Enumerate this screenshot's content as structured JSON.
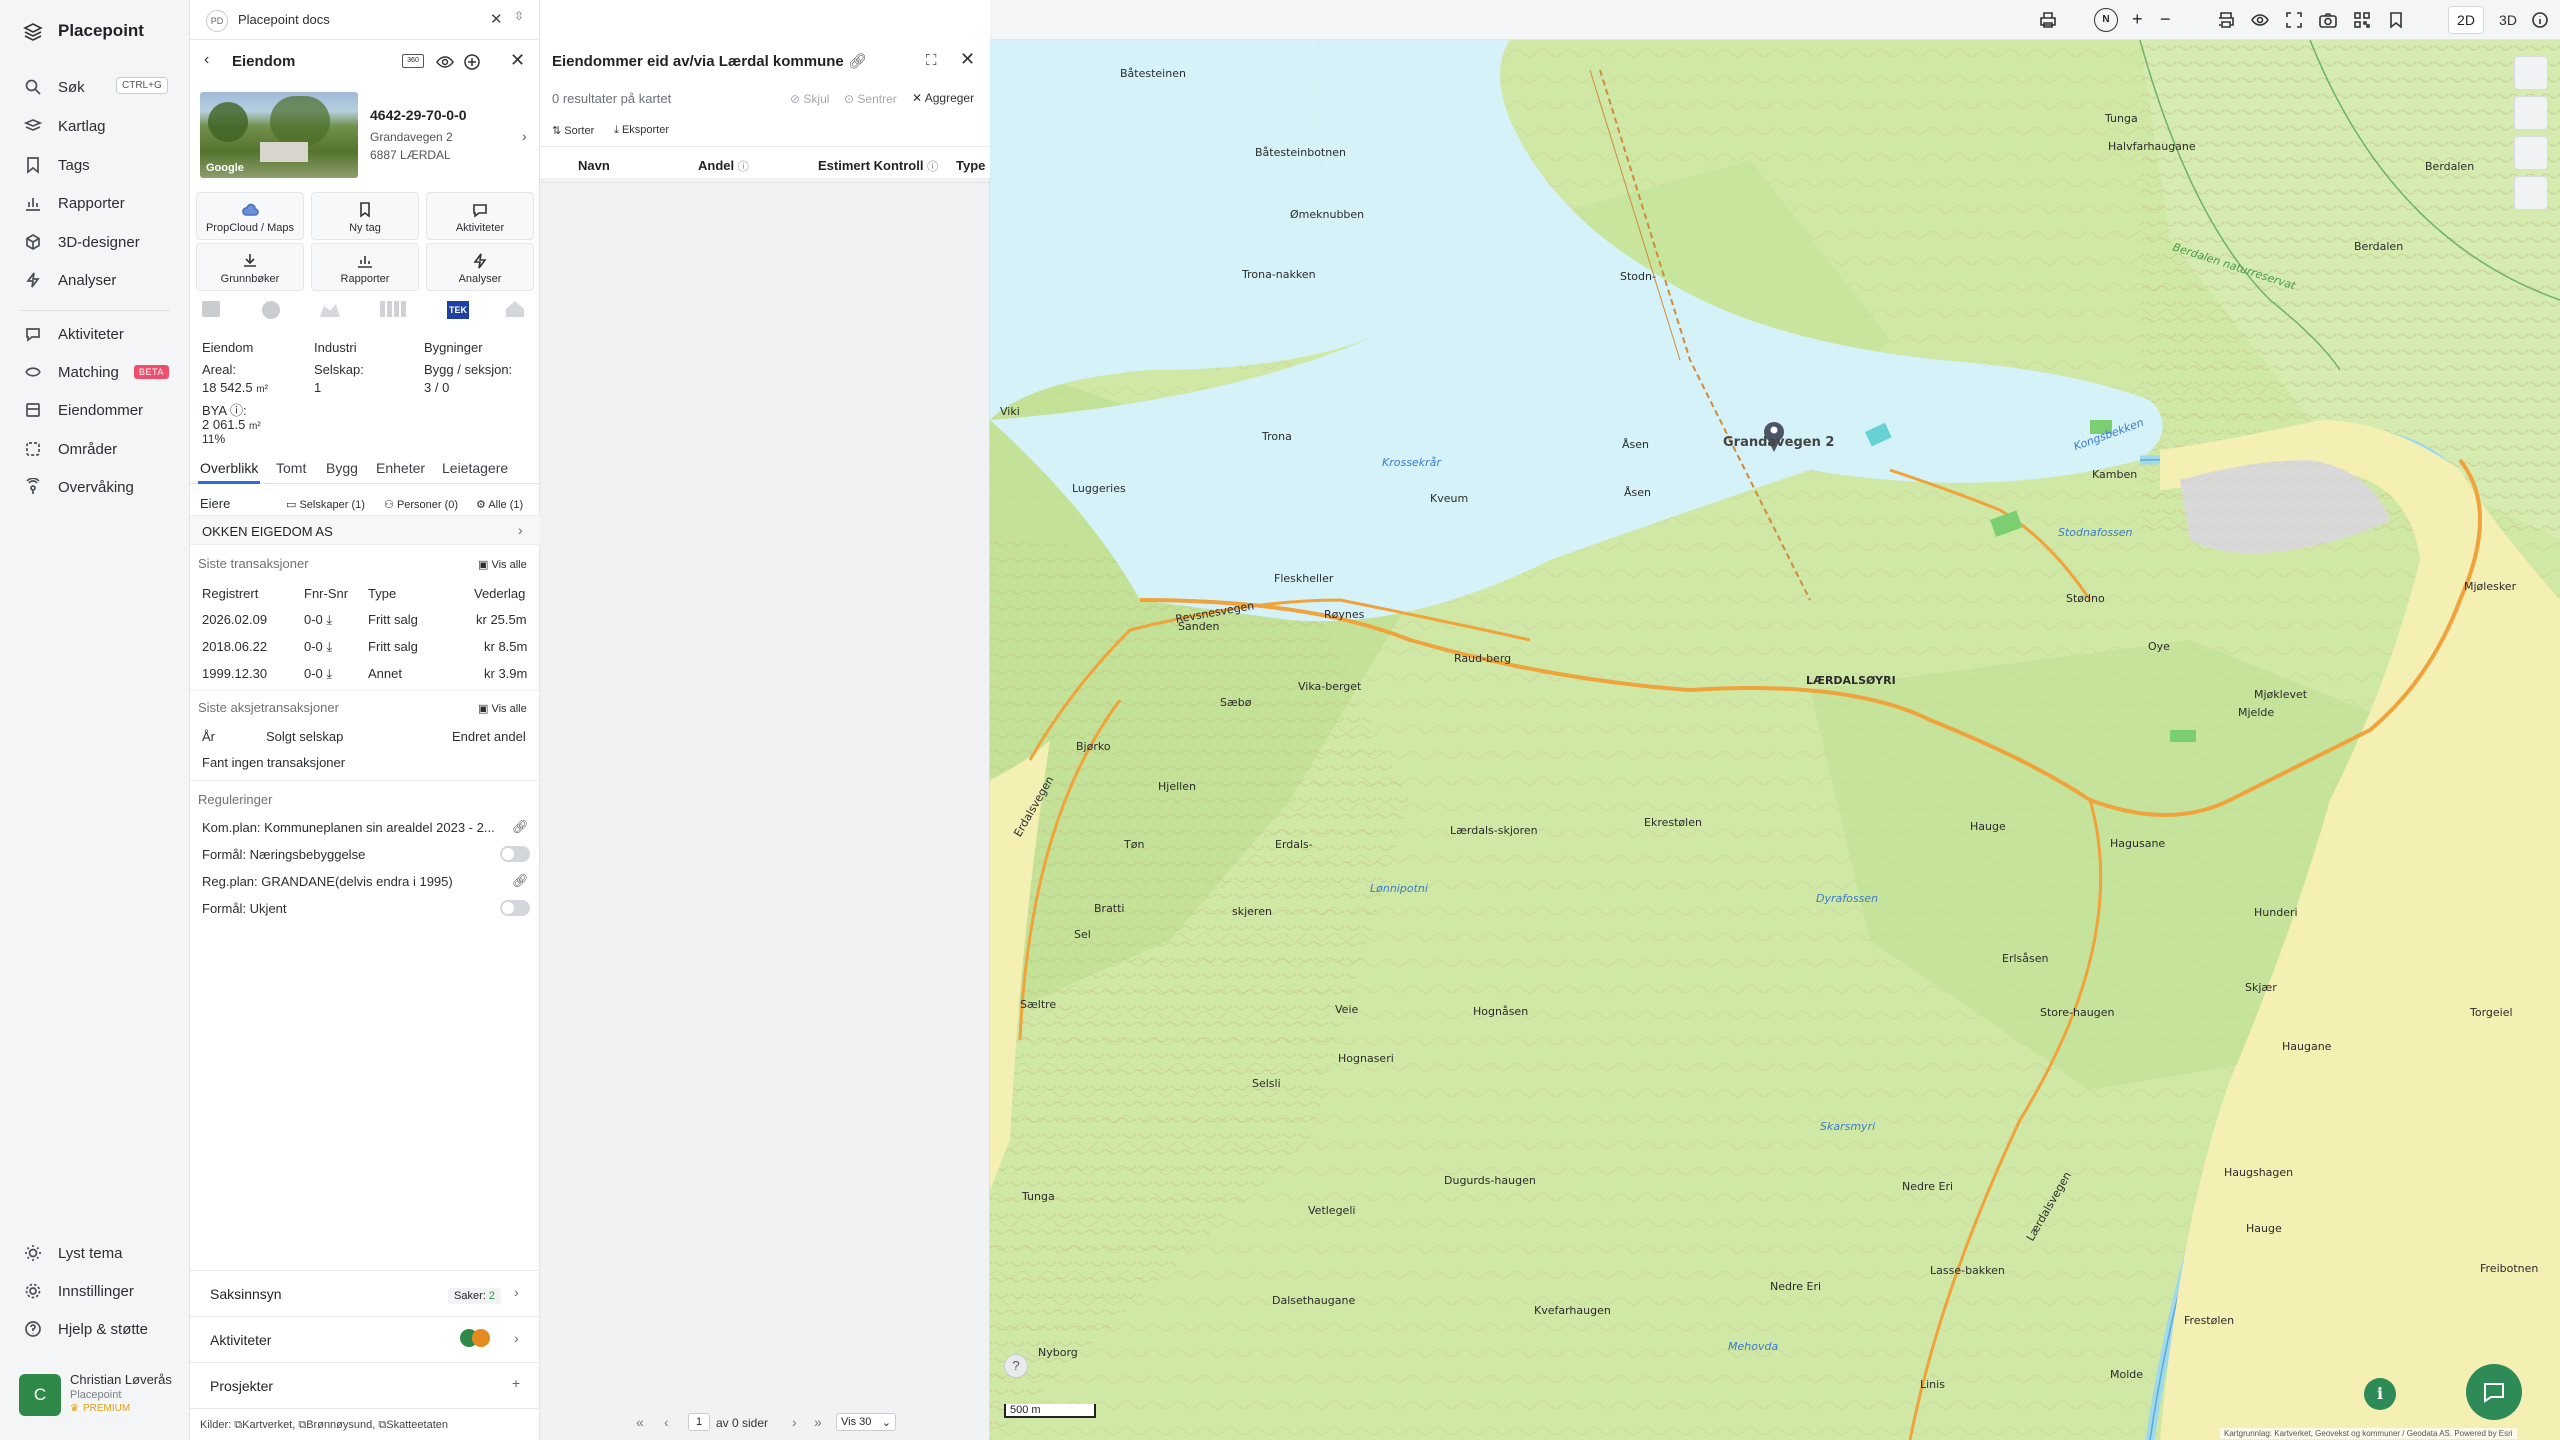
{
  "app": {
    "name": "Placepoint",
    "workspace": "Placepoint docs",
    "workspace_initials": "PD"
  },
  "nav": {
    "items": [
      {
        "label": "Søk",
        "icon": "search-icon",
        "shortcut": "CTRL+G"
      },
      {
        "label": "Kartlag",
        "icon": "layers-icon"
      },
      {
        "label": "Tags",
        "icon": "bookmark-icon"
      },
      {
        "label": "Rapporter",
        "icon": "chart-icon"
      },
      {
        "label": "3D-designer",
        "icon": "cube-icon"
      },
      {
        "label": "Analyser",
        "icon": "lightning-icon"
      },
      {
        "label": "Aktiviteter",
        "icon": "chat-icon"
      },
      {
        "label": "Matching",
        "icon": "matching-icon",
        "badge": "BETA"
      },
      {
        "label": "Eiendommer",
        "icon": "building-icon"
      },
      {
        "label": "Områder",
        "icon": "area-icon"
      },
      {
        "label": "Overvåking",
        "icon": "monitor-icon"
      }
    ],
    "bottom": [
      {
        "label": "Lyst tema",
        "icon": "sun-icon"
      },
      {
        "label": "Innstillinger",
        "icon": "gear-icon"
      },
      {
        "label": "Hjelp & støtte",
        "icon": "help-icon"
      }
    ],
    "user": {
      "initial": "C",
      "name": "Christian Løverås",
      "org": "Placepoint",
      "plan": "PREMIUM"
    }
  },
  "property": {
    "header": "Eiendom",
    "id": "4642-29-70-0-0",
    "address": "Grandavegen 2",
    "postal": "6887 LÆRDAL",
    "photo_credit": "Google",
    "tiles": [
      {
        "label": "PropCloud / Maps",
        "icon": "cloud-icon"
      },
      {
        "label": "Ny tag",
        "icon": "bookmark-icon"
      },
      {
        "label": "Aktiviteter",
        "icon": "chat-icon"
      },
      {
        "label": "Grunnbøker",
        "icon": "download-icon"
      },
      {
        "label": "Rapporter",
        "icon": "chart-icon"
      },
      {
        "label": "Analyser",
        "icon": "lightning-icon"
      }
    ],
    "tek_badge": "TEK",
    "summary": {
      "type_label": "Eiendom",
      "category": "Industri",
      "buildings_label": "Bygninger",
      "area_label": "Areal:",
      "area_value": "18 542.5",
      "area_unit": "m²",
      "company_label": "Selskap:",
      "company_value": "1",
      "byg_label": "Bygg / seksjon:",
      "byg_value": "3 / 0",
      "bya_label": "BYA ⓘ:",
      "bya_value": "2 061.5",
      "bya_unit": "m²",
      "bya_pct": "11%"
    },
    "tabs": [
      "Overblikk",
      "Tomt",
      "Bygg",
      "Enheter",
      "Leietagere"
    ],
    "owners": {
      "label": "Eiere",
      "filters": [
        "Selskaper (1)",
        "Personer (0)",
        "Alle (1)"
      ],
      "list": [
        "OKKEN EIGEDOM AS"
      ]
    },
    "transactions": {
      "title": "Siste transaksjoner",
      "link": "Vis alle",
      "columns": [
        "Registrert",
        "Fnr-Snr",
        "Type",
        "Vederlag"
      ],
      "rows": [
        {
          "date": "2026.02.09",
          "fnr": "0-0",
          "type": "Fritt salg",
          "amount": "kr 25.5m"
        },
        {
          "date": "2018.06.22",
          "fnr": "0-0",
          "type": "Fritt salg",
          "amount": "kr 8.5m"
        },
        {
          "date": "1999.12.30",
          "fnr": "0-0",
          "type": "Annet",
          "amount": "kr 3.9m"
        }
      ]
    },
    "share_tx": {
      "title": "Siste aksjetransaksjoner",
      "link": "Vis alle",
      "columns": [
        "År",
        "Solgt selskap",
        "Endret andel"
      ],
      "empty": "Fant ingen transaksjoner"
    },
    "regulations": {
      "title": "Reguleringer",
      "items": [
        {
          "text": "Kom.plan: Kommuneplanen sin arealdel 2023 - 2...",
          "kind": "link"
        },
        {
          "text": "Formål: Næringsbebyggelse",
          "kind": "toggle"
        },
        {
          "text": "Reg.plan: GRANDANE(delvis endra i 1995)",
          "kind": "link"
        },
        {
          "text": "Formål: Ukjent",
          "kind": "toggle"
        }
      ]
    },
    "bottom_sections": [
      {
        "label": "Saksinnsyn",
        "meta_label": "Saker:",
        "meta_value": "2"
      },
      {
        "label": "Aktiviteter"
      },
      {
        "label": "Prosjekter"
      }
    ],
    "sources": {
      "label": "Kilder:",
      "items": [
        "Kartverket,",
        "Brønnøysund,",
        "Skatteetaten"
      ]
    }
  },
  "result": {
    "title": "Eiendommer eid av/via Lærdal kommune",
    "count_text": "0 resultater på kartet",
    "actions": [
      "Skjul",
      "Sentrer",
      "Aggreger"
    ],
    "tools": [
      "Sorter",
      "Eksporter"
    ],
    "columns": [
      "Navn",
      "Andel",
      "Estimert Kontroll",
      "Type"
    ],
    "pagination": {
      "page": "1",
      "of_text": "av 0 sider",
      "per_page": "Vis 30"
    }
  },
  "map": {
    "mode_2d": "2D",
    "mode_3d": "3D",
    "compass": "N",
    "marker_label": "Grandavegen 2",
    "scale": "500 m",
    "attribution": "Kartgrunnlag: Kartverket, Geovekst og kommuner / Geodata AS. Powered by Esri",
    "labels": {
      "places": [
        "Båtesteinen",
        "Tunga",
        "Berdalen",
        "Halvfarhaugane",
        "Båtesteinbotnen",
        "Ømeknubben",
        "Stodn-",
        "Trona-nakken",
        "Trona",
        "Åsen",
        "Kamben",
        "Åsen",
        "Luggeries",
        "Kveum",
        "Fleskheller",
        "Røynes",
        "Revsnesvegen",
        "Sanden",
        "Raud-berg",
        "LÆRDALSØYRI",
        "Stødno",
        "Oye",
        "Mjelde",
        "Mjøklevet",
        "Viki",
        "Bjørko",
        "Vika-berget",
        "Sæbø",
        "Ekrestølen",
        "Lærdals-skjoren",
        "Erdalsvegen",
        "Hjellen",
        "Tøn",
        "Erdals-",
        "skjeren",
        "Bratti",
        "Sel",
        "Lærdalsvegen",
        "Hauge",
        "Hagusane",
        "Erlsåsen",
        "Hunderi",
        "Skjær",
        "Haugane",
        "Store-haugen",
        "Veie",
        "Hognåsen",
        "Hognaseri",
        "Sæltre",
        "Selsli",
        "Tunga",
        "Dugurds-haugen",
        "Vetlegeli",
        "Kvefarhaugen",
        "Dalsethaugane",
        "Lasse-bakken",
        "Nedre Eri",
        "Nedre Eri",
        "Nyborg",
        "Haugshagen",
        "Hauge",
        "Torgeiel",
        "Frestølen",
        "Freibotnen",
        "Molde",
        "Linis",
        "Berdalen",
        "Mjølesker",
        "Krossekrår"
      ],
      "water": [
        "Krossekrår",
        "Lønnipotni",
        "Dyrafossen",
        "Skarsmyri",
        "Stodnafossen",
        "Kongsbekken",
        "Mehovda",
        "Berdalen naturreservat"
      ]
    }
  }
}
